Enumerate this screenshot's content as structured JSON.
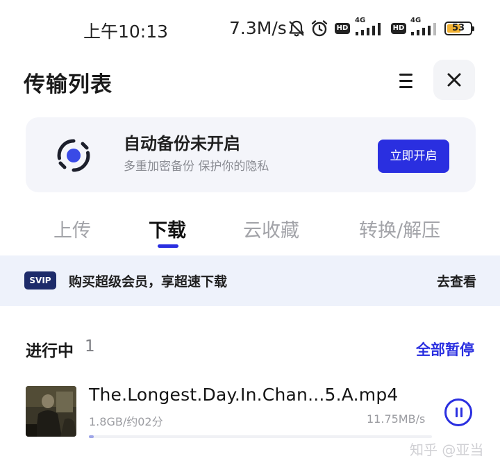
{
  "status_bar": {
    "time": "上午10:13",
    "speed": "7.3M/s",
    "icons": [
      "bell-off-icon",
      "alarm-icon",
      "hd-icon",
      "signal-4g-icon",
      "hd-icon",
      "signal-4g-icon",
      "battery-icon"
    ],
    "hd_label": "HD",
    "network_label": "4G",
    "battery": "53"
  },
  "header": {
    "title": "传输列表",
    "menu_icon": "menu-icon",
    "close_icon": "close-icon"
  },
  "backup_card": {
    "title": "自动备份未开启",
    "subtitle": "多重加密备份 保护你的隐私",
    "button_label": "立即开启",
    "icon": "backup-sync-icon"
  },
  "tabs": [
    {
      "label": "上传",
      "active": false
    },
    {
      "label": "下载",
      "active": true
    },
    {
      "label": "云收藏",
      "active": false
    },
    {
      "label": "转换/解压",
      "active": false
    }
  ],
  "promo": {
    "badge": "SVIP",
    "text": "购买超级会员，享超速下载",
    "link": "去查看"
  },
  "section": {
    "label": "进行中",
    "count": "1",
    "action": "全部暂停"
  },
  "downloads": [
    {
      "name": "The.Longest.Day.In.Chan...5.A.mp4",
      "size_info": "1.8GB/约02分",
      "speed": "11.75MB/s",
      "progress": 0.015,
      "action_icon": "pause-icon"
    }
  ],
  "watermark": "知乎 @亚当",
  "colors": {
    "accent": "#2a2fe0",
    "promo_bg": "#eef2fb",
    "card_bg": "#f4f5fa",
    "svip": "#1d2b6a",
    "battery": "#f2b233"
  }
}
